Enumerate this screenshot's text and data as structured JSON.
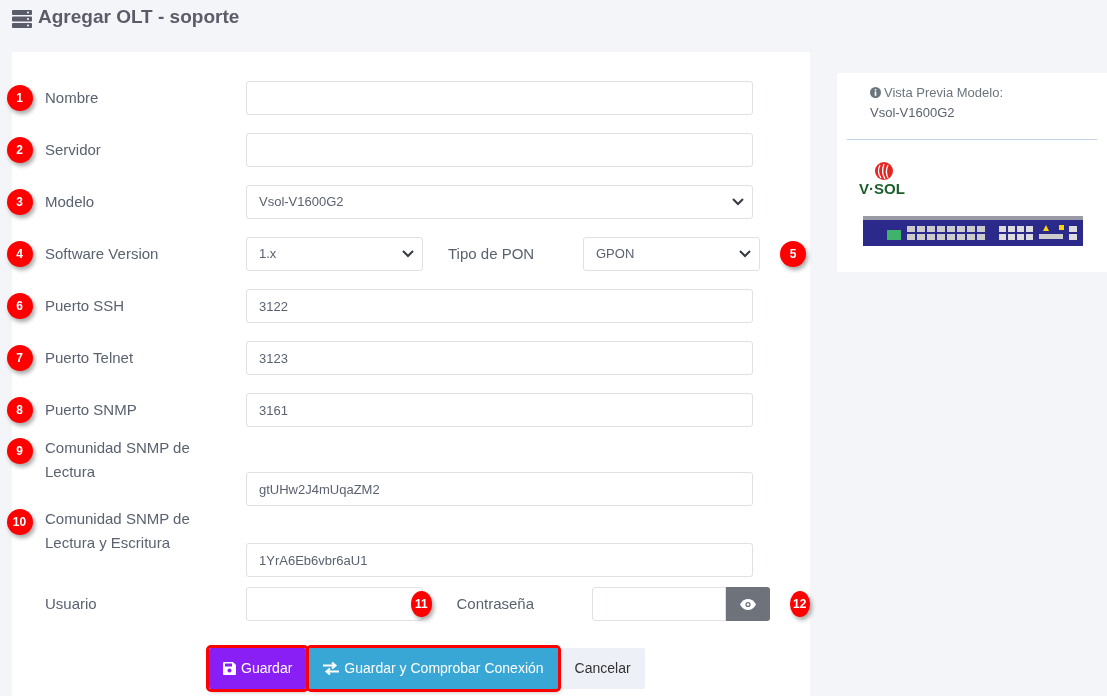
{
  "title": "Agregar OLT - soporte",
  "rows": [
    {
      "items": [
        {
          "marker": "1",
          "marker_after": false,
          "label": "Nombre",
          "kind": "text"
        }
      ]
    },
    {
      "items": [
        {
          "marker": "2",
          "marker_after": false,
          "label": "Servidor",
          "kind": "text"
        }
      ]
    },
    {
      "items": [
        {
          "marker": "3",
          "marker_after": false,
          "label": "Modelo",
          "kind": "select",
          "value": "Vsol-V1600G2"
        }
      ]
    },
    {
      "items": [
        {
          "marker": "4",
          "marker_after": false,
          "label": "Software Version",
          "kind": "select",
          "value": "1.x"
        },
        {
          "marker": "5",
          "marker_after": true,
          "label": "Tipo de PON",
          "kind": "select",
          "value": "GPON"
        }
      ]
    },
    {
      "items": [
        {
          "marker": "6",
          "marker_after": false,
          "label": "Puerto SSH",
          "kind": "text",
          "value": "3122"
        }
      ]
    },
    {
      "items": [
        {
          "marker": "7",
          "marker_after": false,
          "label": "Puerto Telnet",
          "kind": "text",
          "value": "3123"
        }
      ]
    },
    {
      "items": [
        {
          "marker": "8",
          "marker_after": false,
          "label": "Puerto SNMP",
          "kind": "text",
          "value": "3161"
        }
      ]
    },
    {
      "items": [
        {
          "marker": "9",
          "marker_after": false,
          "label": "Comunidad SNMP de Lectura",
          "kind": "text",
          "value": "gtUHw2J4mUqaZM2"
        }
      ]
    },
    {
      "items": [
        {
          "marker": "10",
          "marker_after": false,
          "label": "Comunidad SNMP de Lectura y Escritura",
          "kind": "text",
          "value": "1YrA6Eb6vbr6aU1"
        }
      ]
    },
    {
      "items": [
        {
          "marker": "11",
          "marker_after": true,
          "label": "Usuario",
          "kind": "text"
        },
        {
          "marker": "12",
          "marker_after": true,
          "label": "Contraseña",
          "kind": "password"
        }
      ]
    }
  ],
  "buttons": [
    {
      "label": "Guardar",
      "kind": "save",
      "highlighted": true
    },
    {
      "label": "Guardar y Comprobar Conexión",
      "kind": "check",
      "highlighted": true
    },
    {
      "label": "Cancelar",
      "kind": "cancel",
      "highlighted": false
    }
  ],
  "preview": {
    "heading": "Vista Previa Modelo:",
    "model": "Vsol-V1600G2",
    "logo_text": "V·SOL"
  }
}
